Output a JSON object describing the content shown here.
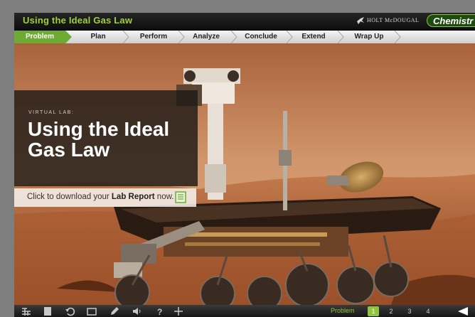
{
  "header": {
    "title": "Using the Ideal Gas Law",
    "publisher": "HOLT McDOUGAL",
    "brand": "Chemistr"
  },
  "steps": [
    {
      "label": "Problem",
      "active": true
    },
    {
      "label": "Plan",
      "active": false
    },
    {
      "label": "Perform",
      "active": false
    },
    {
      "label": "Analyze",
      "active": false
    },
    {
      "label": "Conclude",
      "active": false
    },
    {
      "label": "Extend",
      "active": false
    },
    {
      "label": "Wrap Up",
      "active": false
    }
  ],
  "intro": {
    "kicker": "VIRTUAL LAB:",
    "title": "Using the Ideal Gas Law"
  },
  "download": {
    "text_prefix": "Click to download your ",
    "text_bold": "Lab Report",
    "text_suffix": " now."
  },
  "toolbar": {
    "tools": [
      "periodic-table-icon",
      "notebook-icon",
      "undo-icon",
      "screen-icon",
      "pencil-icon",
      "speaker-icon",
      "help-icon",
      "crosshair-icon"
    ],
    "page_label": "Problem",
    "pages": [
      "1",
      "2",
      "3",
      "4"
    ],
    "current_page": "1"
  },
  "colors": {
    "accent_green": "#6dab34",
    "title_green": "#9fd23a",
    "mars_sky": "#c9855a",
    "mars_ground": "#b5653a"
  }
}
